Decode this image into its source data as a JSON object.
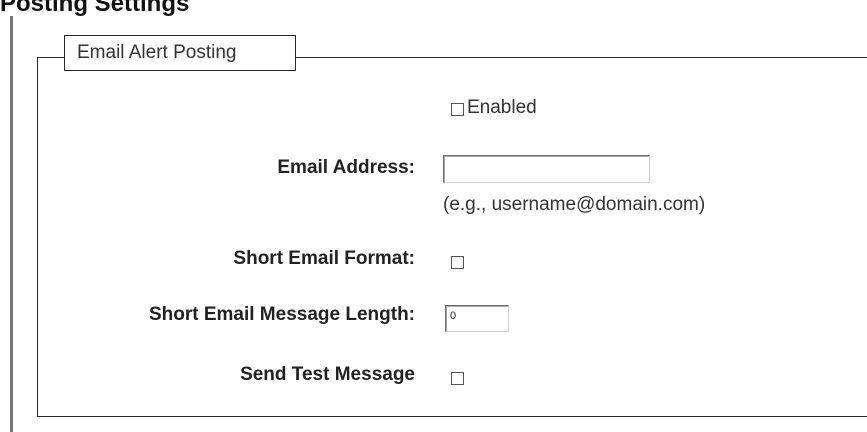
{
  "page": {
    "title": "Posting Settings"
  },
  "section": {
    "legend": "Email Alert Posting"
  },
  "enabled": {
    "label": "Enabled",
    "checked": false
  },
  "email_address": {
    "label": "Email Address:",
    "value": "",
    "hint": "(e.g., username@domain.com)"
  },
  "short_format": {
    "label": "Short Email Format:",
    "checked": false
  },
  "short_length": {
    "label": "Short Email Message Length:",
    "value": "0"
  },
  "send_test": {
    "label": "Send Test Message",
    "checked": false
  }
}
